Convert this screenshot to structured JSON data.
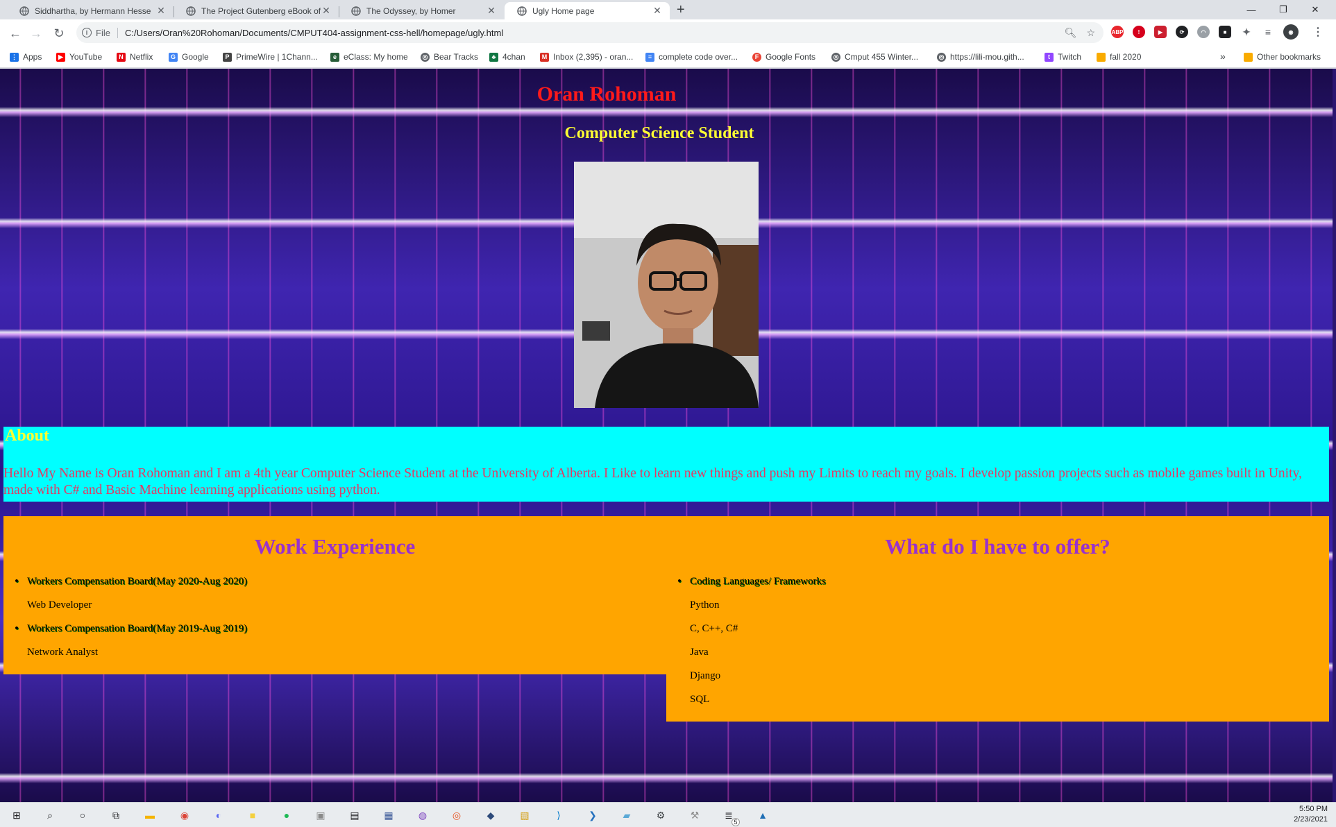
{
  "browser": {
    "tabs": [
      {
        "title": "Siddhartha, by Hermann Hesse"
      },
      {
        "title": "The Project Gutenberg eBook of"
      },
      {
        "title": "The Odyssey, by Homer"
      },
      {
        "title": "Ugly Home page"
      }
    ],
    "address": {
      "scheme": "File",
      "url": "C:/Users/Oran%20Rohoman/Documents/CMPUT404-assignment-css-hell/homepage/ugly.html"
    },
    "bookmarks": [
      {
        "label": "Apps",
        "icon": "apps-grid-icon",
        "color": "#1a73e8"
      },
      {
        "label": "YouTube",
        "icon": "youtube-icon",
        "color": "#ff0000"
      },
      {
        "label": "Netflix",
        "icon": "netflix-icon",
        "color": "#e50914"
      },
      {
        "label": "Google",
        "icon": "google-icon",
        "color": "#4285f4"
      },
      {
        "label": "PrimeWire | 1Chann...",
        "icon": "primewire-icon",
        "color": "#444444"
      },
      {
        "label": "eClass: My home",
        "icon": "eclass-icon",
        "color": "#275d38"
      },
      {
        "label": "Bear Tracks",
        "icon": "globe-icon",
        "color": "#5f6368"
      },
      {
        "label": "4chan",
        "icon": "clover-icon",
        "color": "#117743"
      },
      {
        "label": "Inbox (2,395) - oran...",
        "icon": "gmail-icon",
        "color": "#d93025"
      },
      {
        "label": "complete code over...",
        "icon": "docs-icon",
        "color": "#4285f4"
      },
      {
        "label": "Google Fonts",
        "icon": "google-fonts-icon",
        "color": "#ea4335"
      },
      {
        "label": "Cmput 455 Winter...",
        "icon": "globe-icon",
        "color": "#5f6368"
      },
      {
        "label": "https://lili-mou.gith...",
        "icon": "globe-icon",
        "color": "#5f6368"
      },
      {
        "label": "Twitch",
        "icon": "twitch-icon",
        "color": "#9146ff"
      },
      {
        "label": "fall 2020",
        "icon": "folder-icon",
        "color": "#f9ab00"
      }
    ],
    "overflow": "»",
    "other_bookmarks": "Other bookmarks"
  },
  "page": {
    "name": "Oran Rohoman",
    "subtitle": "Computer Science Student",
    "about": {
      "heading": "About",
      "text": "Hello My Name is Oran Rohoman and I am a 4th year Computer Science Student at the University of Alberta. I Like to learn new things and push my Limits to reach my goals. I develop passion projects such as mobile games built in Unity, made with C# and Basic Machine learning applications using python."
    },
    "work": {
      "heading": "Work Experience",
      "items": [
        {
          "text": "Workers Compensation Board(May 2020-Aug 2020)",
          "bullet": true
        },
        {
          "text": "Web Developer",
          "bullet": false
        },
        {
          "text": "Workers Compensation Board(May 2019-Aug 2019)",
          "bullet": true
        },
        {
          "text": "Network Analyst",
          "bullet": false
        }
      ]
    },
    "offer": {
      "heading": "What do I have to offer?",
      "items": [
        {
          "text": "Coding Languages/ Frameworks",
          "bullet": true
        },
        {
          "text": "Python",
          "bullet": false
        },
        {
          "text": "C, C++, C#",
          "bullet": false
        },
        {
          "text": "Java",
          "bullet": false
        },
        {
          "text": "Django",
          "bullet": false
        },
        {
          "text": "SQL",
          "bullet": false
        }
      ]
    }
  },
  "taskbar": {
    "time": "5:50 PM",
    "date": "2/23/2021",
    "badge": "5"
  },
  "colors": {
    "name": "#ff1a1a",
    "subtitle": "#ffff33",
    "about_bg": "#00ffff",
    "about_text": "#e23a64",
    "card_bg": "#ffa500",
    "card_heading": "#9932cc"
  }
}
